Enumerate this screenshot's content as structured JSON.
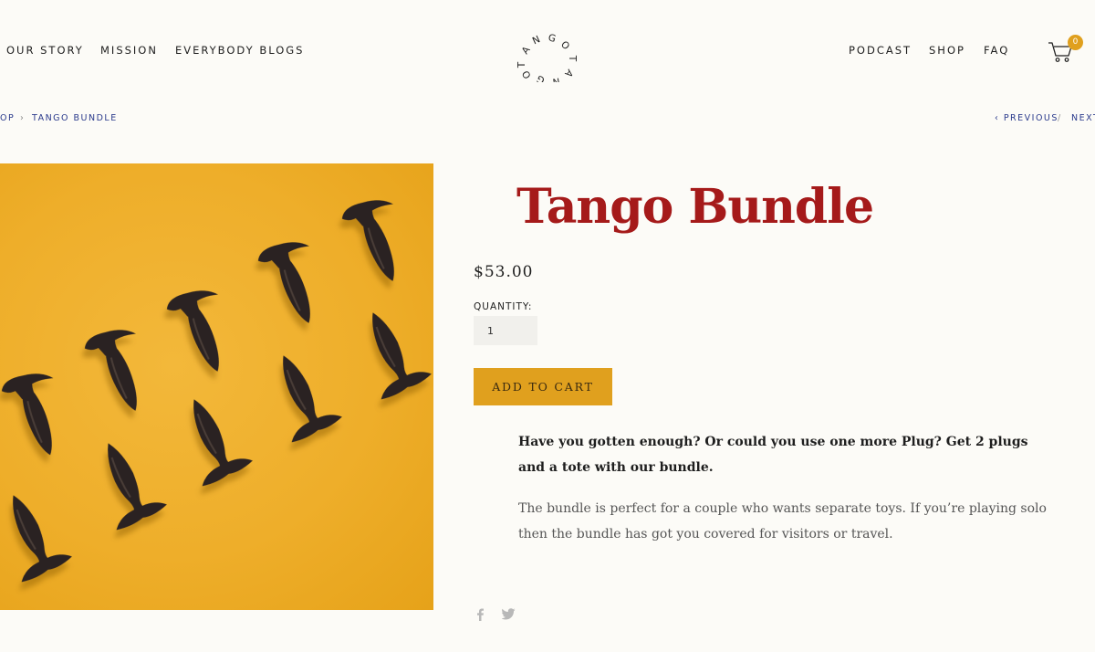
{
  "nav": {
    "left": [
      "OUR STORY",
      "MISSION",
      "EVERYBODY BLOGS"
    ],
    "right": [
      "PODCAST",
      "SHOP",
      "FAQ"
    ]
  },
  "logo": {
    "text": "TANGO TANGO"
  },
  "cart": {
    "count": "0",
    "icon": "cart-icon"
  },
  "breadcrumb": {
    "parent": "OP",
    "separator": "›",
    "current": "TANGO BUNDLE"
  },
  "pager": {
    "previous": "‹ PREVIOUS",
    "separator": "/",
    "next": "NEXT"
  },
  "product": {
    "title": "Tango Bundle",
    "price": "$53.00",
    "quantity_label": "QUANTITY:",
    "quantity_value": "1",
    "add_to_cart": "ADD TO CART",
    "description_strong": "Have you gotten enough? Or could you use one more Plug? Get 2 plugs and a tote with our bundle.",
    "description_body": "The bundle is perfect for a couple who wants separate toys. If you’re playing solo then the bundle has got you covered for visitors or travel."
  },
  "share": {
    "icons": [
      "facebook-icon",
      "twitter-icon"
    ]
  },
  "colors": {
    "background": "#fcfbf7",
    "title": "#a51a1a",
    "accent": "#e0a01e",
    "link": "#2a3a8c"
  }
}
